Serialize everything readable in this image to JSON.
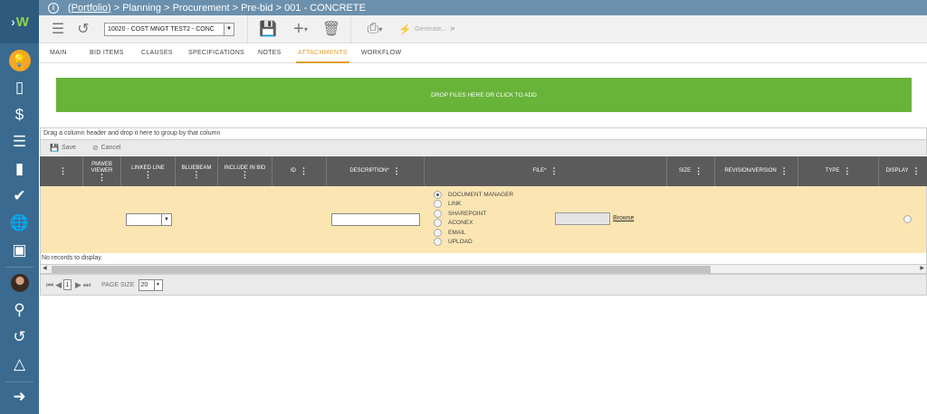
{
  "breadcrumb": {
    "portfolio_link": "(Portfolio)",
    "rest": " > Planning > Procurement > Pre-bid > 001 - CONCRETE"
  },
  "toolbar": {
    "record_select": "10020 - COST MNGT TEST2 - CONC",
    "generate_label": "Generate..."
  },
  "tabs": [
    "Main",
    "Bid Items",
    "Clauses",
    "Specifications",
    "Notes",
    "Attachments",
    "Workflow"
  ],
  "active_tab": "Attachments",
  "dropzone_text": "Drop files here or click to add",
  "group_hint": "Drag a column header and drop it here to group by that column",
  "grid_actions": {
    "save": "Save",
    "cancel": "Cancel"
  },
  "columns": [
    "PMWeb Viewer",
    "Linked Line",
    "Bluebeam",
    "Include in Bid",
    "ID",
    "Description*",
    "File*",
    "Size",
    "Revision/Version",
    "Type",
    "Display"
  ],
  "file_sources": [
    "Document Manager",
    "Link",
    "SharePoint",
    "Aconex",
    "Email",
    "Upload"
  ],
  "selected_source": "Document Manager",
  "browse_label": "Browse",
  "no_records": "No records to display.",
  "pager": {
    "page": "1",
    "page_size_label": "PAGE SIZE",
    "page_size": "20"
  },
  "colors": {
    "sidebar": "#3a6a8f",
    "topbar": "#6b90ad",
    "accent": "#e0a030",
    "dropzone": "#68b43a",
    "row": "#fbe6b3"
  }
}
